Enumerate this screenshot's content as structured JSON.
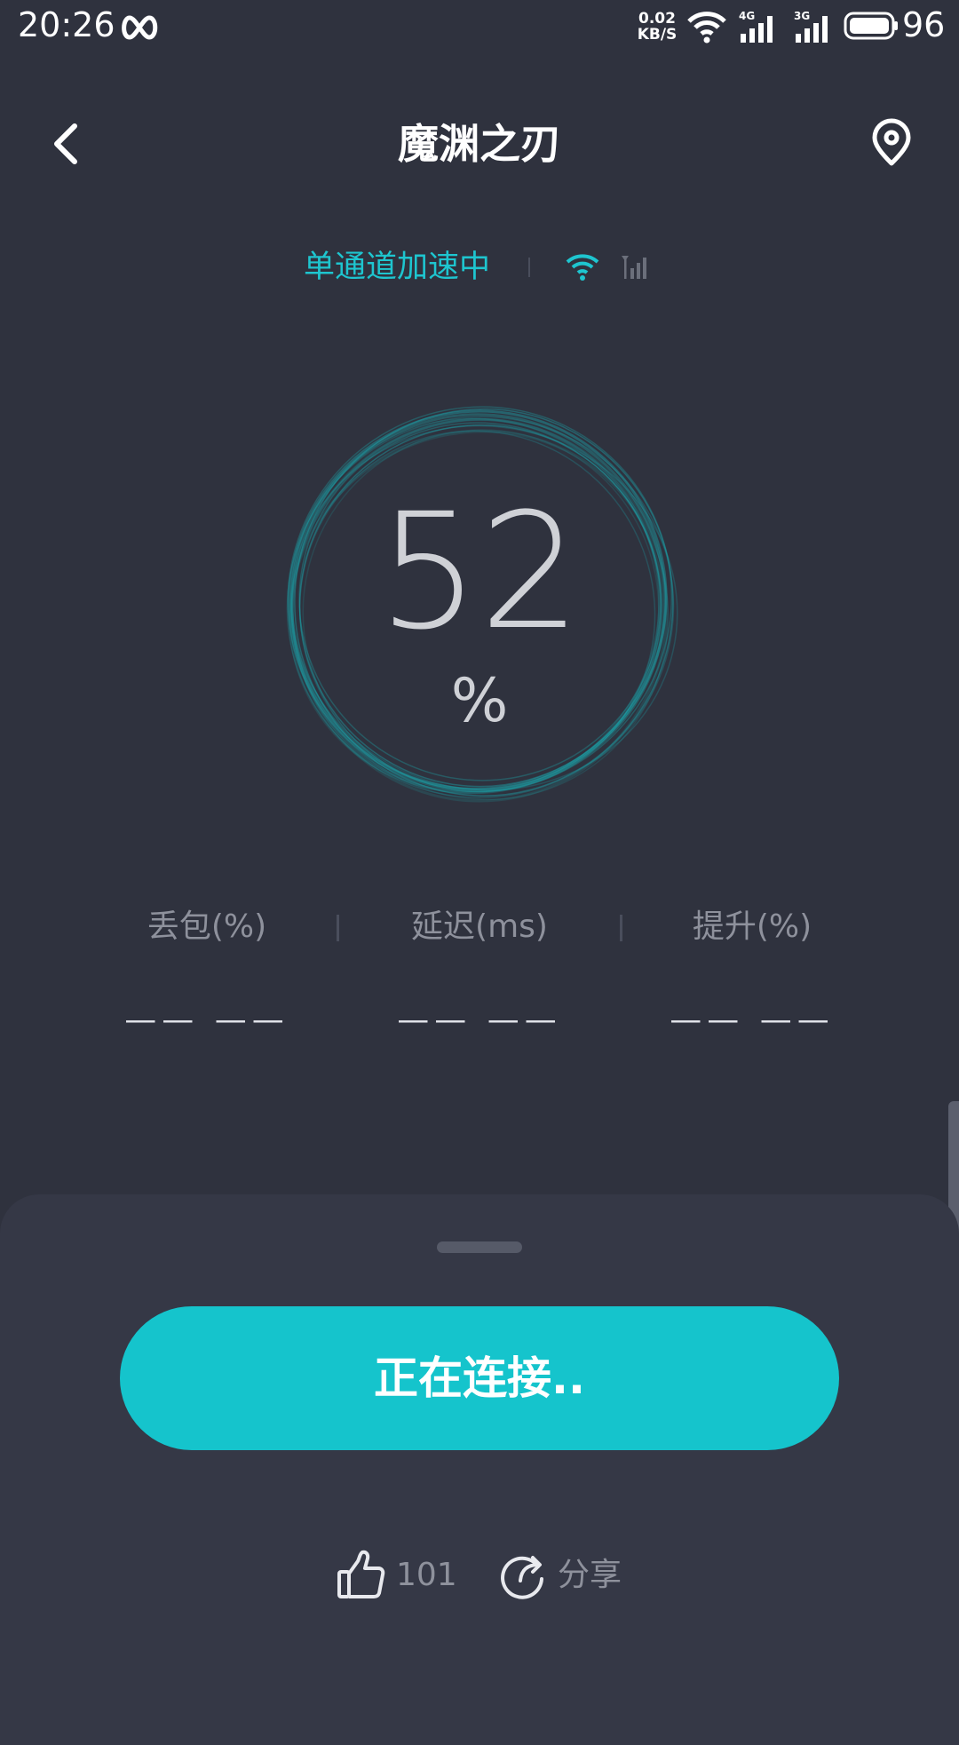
{
  "status_bar": {
    "time": "20:26",
    "speed_value": "0.02",
    "speed_unit": "KB/S",
    "network_4g": "4G",
    "network_3g": "3G",
    "battery": "96"
  },
  "header": {
    "title": "魔渊之刃"
  },
  "mode": {
    "label": "单通道加速中"
  },
  "progress": {
    "value": "52",
    "unit": "%",
    "percent": 52
  },
  "stats": [
    {
      "label": "丢包(%)",
      "value": "—— ——"
    },
    {
      "label": "延迟(ms)",
      "value": "—— ——"
    },
    {
      "label": "提升(%)",
      "value": "—— ——"
    }
  ],
  "connect_button": {
    "label": "正在连接.."
  },
  "footer": {
    "like_count": "101",
    "share_label": "分享"
  },
  "colors": {
    "background": "#2f323e",
    "sheet": "#353846",
    "accent": "#15c4cc",
    "muted_text": "#8e919c"
  },
  "icons": {
    "back": "chevron-left-icon",
    "location": "location-pin-icon",
    "wifi": "wifi-icon",
    "cellular": "cellular-signal-icon",
    "like": "thumbs-up-icon",
    "share": "share-arrow-icon"
  }
}
